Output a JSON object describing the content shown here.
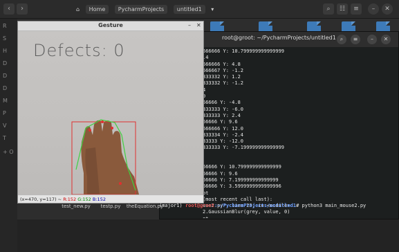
{
  "file_manager": {
    "path_home": "Home",
    "path_items": [
      "PycharmProjects",
      "untitled1"
    ],
    "sidebar": [
      "R",
      "S",
      "H",
      "D",
      "D",
      "D",
      "M",
      "P",
      "V",
      "T",
      "+ O"
    ]
  },
  "files": [
    {
      "label": "test_new.py"
    },
    {
      "label": "testp.py"
    },
    {
      "label": "theEquation.py"
    }
  ],
  "terminal": {
    "title": "root@groot: ~/PycharmProjects/untitled1",
    "lines": [
      "666666 Y: 10.799999999999999",
      ".4",
      "666666 Y: 4.8",
      "666667 Y: -1.2",
      "333332 Y: 1.2",
      "333332 Y: -1.2",
      "4",
      "0",
      "66666 Y: -4.8",
      "333333 Y: -6.0",
      "333333 Y: 2.4",
      "66666 Y: 9.6",
      "666666 Y: 12.0",
      "333334 Y: -2.4",
      "33333 Y: -12.0",
      "333333 Y: -7.199999999999999",
      "",
      "",
      "66666 Y: 10.799999999999999",
      "66666 Y: 9.6",
      "66666 Y: 7.199999999999999",
      "66666 Y: 3.5999999999999996",
      "ot",
      "(most recent call last):",
      "use2.py\", line 23, in <module>",
      "2.GaussianBlur(grey, value, 0)",
      "ot"
    ],
    "prompt_prefix": "(major1) ",
    "prompt_user": "root@groot",
    "prompt_path": ":~/PycharmProjects/untitled1",
    "prompt_cmd": "# python3 main_mouse2.py"
  },
  "gesture": {
    "title": "Gesture",
    "defects_label": "Defects: 0",
    "status_coords": "(x=470, y=117) ~ ",
    "status_r": "R:152",
    "status_g": "G:152",
    "status_b": "B:152",
    "minimize": "–",
    "close": "✕"
  }
}
